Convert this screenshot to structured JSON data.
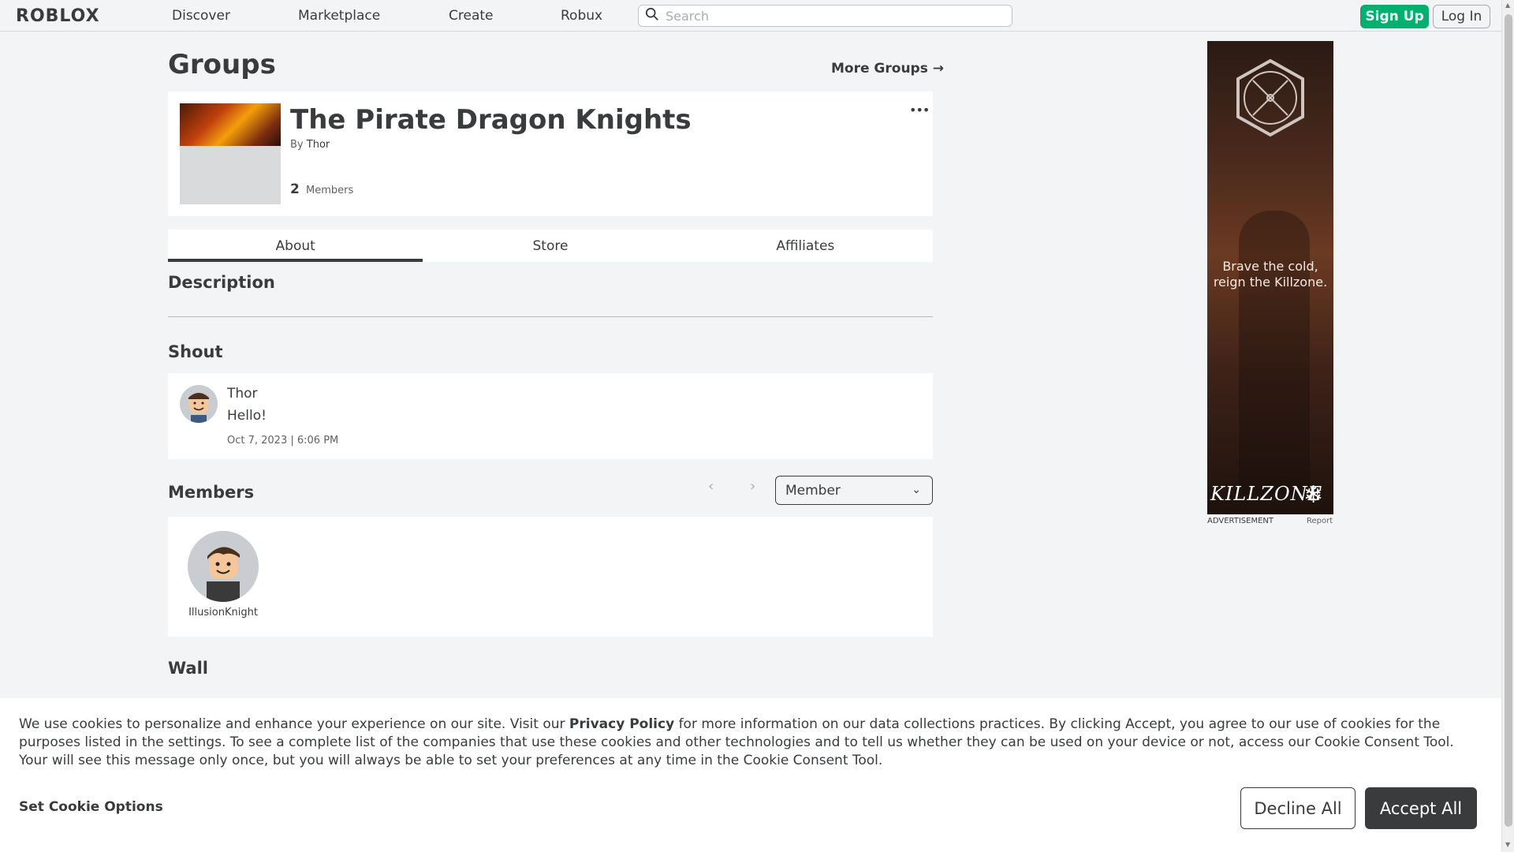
{
  "header": {
    "logo": "ROBLOX",
    "nav": [
      "Discover",
      "Marketplace",
      "Create",
      "Robux"
    ],
    "search_placeholder": "Search",
    "signup_label": "Sign Up",
    "login_label": "Log In"
  },
  "page": {
    "title": "Groups",
    "more_groups": "More Groups →"
  },
  "group": {
    "name": "The Pirate Dragon Knights",
    "by_prefix": "By",
    "owner": "Thor",
    "member_count": "2",
    "member_label": "Members",
    "menu_icon": "ellipsis-icon"
  },
  "tabs": [
    "About",
    "Store",
    "Affiliates"
  ],
  "active_tab": "About",
  "sections": {
    "description": "Description",
    "shout": "Shout",
    "members": "Members",
    "wall": "Wall"
  },
  "shout": {
    "author": "Thor",
    "message": "Hello!",
    "time": "Oct 7, 2023 | 6:06 PM"
  },
  "members": {
    "role_select": "Member",
    "list": [
      {
        "name": "IllusionKnight"
      }
    ]
  },
  "ad": {
    "tagline": "Brave the cold, reign the Killzone.",
    "brand": "KILLZONE",
    "label": "ADVERTISEMENT",
    "report": "Report"
  },
  "cookie": {
    "text_before": "We use cookies to personalize and enhance your experience on our site. Visit our ",
    "privacy_link": "Privacy Policy",
    "text_after": " for more information on our data collections practices. By clicking Accept, you agree to our use of cookies for the purposes listed in the settings. To see a complete list of the companies that use these cookies and other technologies and to tell us whether they can be used on your device or not, access our Cookie Consent Tool. Your will see this message only once, but you will always be able to set your preferences at any time in the Cookie Consent Tool.",
    "options_label": "Set Cookie Options",
    "decline_label": "Decline All",
    "accept_label": "Accept All"
  },
  "colors": {
    "accent_green": "#00b06f",
    "text_dark": "#393b3d",
    "background": "#f2f4f5"
  }
}
